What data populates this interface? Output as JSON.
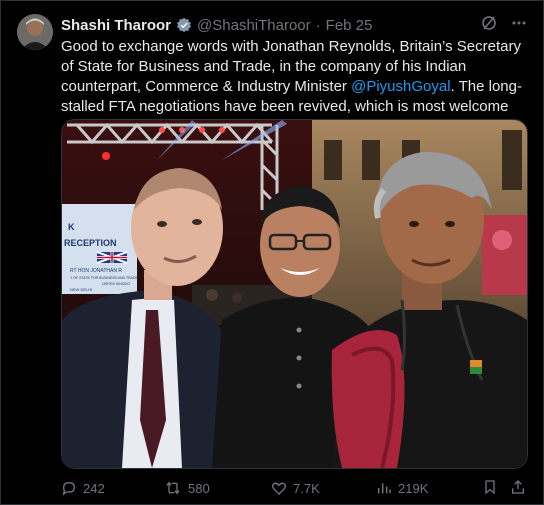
{
  "author": {
    "name": "Shashi Tharoor",
    "handle": "@ShashiTharoor",
    "separator": "·",
    "date": "Feb 25"
  },
  "tweet": {
    "text_before": "Good to exchange words with Jonathan Reynolds, Britain’s Secretary of State for Business and Trade, in the company of his Indian counterpart, Commerce & Industry Minister ",
    "mention": "@PiyushGoyal",
    "text_after": ". The long-stalled FTA negotiations have been revived, which is most welcome"
  },
  "photo": {
    "banner_line1": "K",
    "banner_line2": "RECEPTION",
    "banner_line3": "RT HON JONATHAN R",
    "banner_line4": "Y OF STATE FOR BUSINESS AND TRADE",
    "banner_line5": "UNITED KINGDO",
    "banner_line6": "NEW DELHI"
  },
  "actions": {
    "replies": "242",
    "reposts": "580",
    "likes": "7.7K",
    "views": "219K"
  },
  "colors": {
    "accent": "#1d9bf0",
    "muted": "#71767b",
    "text": "#e7e9ea",
    "background": "#000000"
  }
}
